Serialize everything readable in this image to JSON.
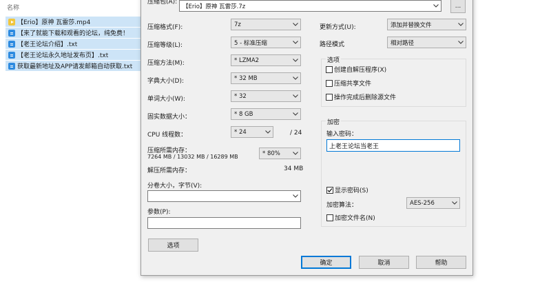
{
  "explorer": {
    "column_header": "名称",
    "files": [
      {
        "name": "【Erio】原神 瓦雷莎.mp4",
        "icon": "video-file-icon"
      },
      {
        "name": "【来了就能下载和观看的论坛，纯免费！",
        "icon": "text-file-icon"
      },
      {
        "name": "【老王论坛介绍】.txt",
        "icon": "text-file-icon"
      },
      {
        "name": "【老王论坛永久地址发布页】.txt",
        "icon": "text-file-icon"
      },
      {
        "name": "获取最新地址及APP请发邮箱自动获取.txt",
        "icon": "text-file-icon"
      }
    ]
  },
  "dialog": {
    "archive_label": "压缩包(A):",
    "archive_value": "【Erio】原神 瓦雷莎.7z",
    "browse_label": "...",
    "format_label": "压缩格式(F):",
    "format_value": "7z",
    "level_label": "压缩等级(L):",
    "level_value": "5 - 标准压缩",
    "method_label": "压缩方法(M):",
    "method_value": "* LZMA2",
    "dict_label": "字典大小(D):",
    "dict_value": "* 32 MB",
    "word_label": "单词大小(W):",
    "word_value": "* 32",
    "solid_label": "固实数据大小：",
    "solid_value": "* 8 GB",
    "cpu_label": "CPU 线程数：",
    "cpu_value": "* 24",
    "cpu_total": "/ 24",
    "mem_comp_label": "压缩所需内存：",
    "mem_comp_value": "7264 MB / 13032 MB / 16289 MB",
    "mem_percent": "* 80%",
    "mem_decomp_label": "解压所需内存：",
    "mem_decomp_value": "34 MB",
    "split_label": "分卷大小，字节(V):",
    "split_value": "",
    "params_label": "参数(P):",
    "params_value": "",
    "options_button": "选项",
    "update_label": "更新方式(U):",
    "update_value": "添加并替换文件",
    "path_label": "路径模式",
    "path_value": "相对路径",
    "options_group": {
      "title": "选项",
      "sfx": "创建自解压程序(X)",
      "shared": "压缩共享文件",
      "delete": "操作完成后删除源文件"
    },
    "encryption_group": {
      "title": "加密",
      "password_label": "输入密码：",
      "password_value": "上老王论坛当老王",
      "show_password": "显示密码(S)",
      "method_label": "加密算法：",
      "method_value": "AES-256",
      "encrypt_names": "加密文件名(N)"
    },
    "ok_button": "确定",
    "cancel_button": "取消",
    "help_button": "帮助"
  },
  "colors": {
    "selection": "#cde4f7",
    "dialog_bg": "#f0f0f0",
    "accent": "#0078d7"
  }
}
